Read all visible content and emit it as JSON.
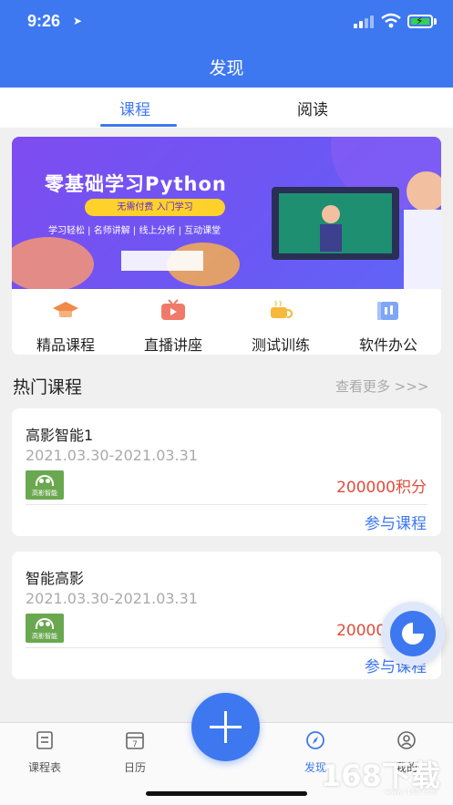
{
  "status": {
    "time": "9:26"
  },
  "header": {
    "title": "发现"
  },
  "tabs": [
    {
      "label": "课程"
    },
    {
      "label": "阅读"
    }
  ],
  "banner": {
    "title": "零基础学习Python",
    "pill": "无需付费 入门学习",
    "subtitle": "学习轻松 | 名师讲解 | 线上分析 | 互动课堂"
  },
  "quick_menu": [
    {
      "label": "精品课程",
      "icon": "graduation-cap-icon"
    },
    {
      "label": "直播讲座",
      "icon": "tv-play-icon"
    },
    {
      "label": "测试训练",
      "icon": "coffee-cup-icon"
    },
    {
      "label": "软件办公",
      "icon": "office-folder-icon"
    }
  ],
  "hot": {
    "title": "热门课程",
    "more": "查看更多 >>>"
  },
  "courses": [
    {
      "name": "高影智能1",
      "date": "2021.03.30-2021.03.31",
      "logo_text": "高影智能",
      "points": "200000积分",
      "join": "参与课程"
    },
    {
      "name": "智能高影",
      "date": "2021.03.30-2021.03.31",
      "logo_text": "高影智能",
      "points": "200000积分",
      "join": "参与课程"
    }
  ],
  "bottom_nav": [
    {
      "label": "课程表",
      "icon": "schedule-icon"
    },
    {
      "label": "日历",
      "icon": "calendar-icon",
      "day": "7"
    },
    {
      "label": "发现",
      "icon": "compass-icon"
    },
    {
      "label": "我的",
      "icon": "user-icon"
    }
  ],
  "watermark": {
    "text": "168下载",
    "url": "www.i168.com"
  },
  "colors": {
    "primary": "#3e78f0",
    "points": "#e04d3a"
  }
}
